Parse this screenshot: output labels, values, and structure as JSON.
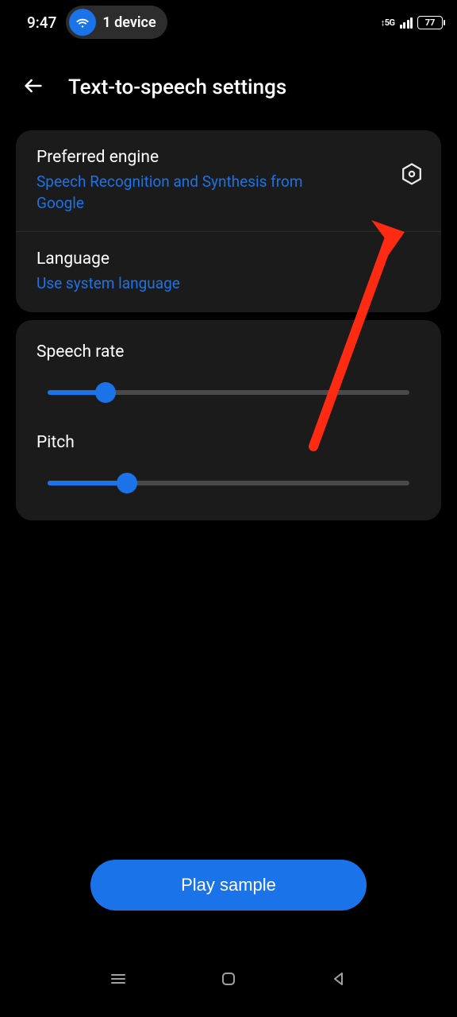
{
  "statusbar": {
    "time": "9:47",
    "deviceCount": "1 device",
    "network": "5G",
    "batteryPct": "77"
  },
  "header": {
    "title": "Text-to-speech settings"
  },
  "engine": {
    "title": "Preferred engine",
    "value": "Speech Recognition and Synthesis from Google"
  },
  "language": {
    "title": "Language",
    "value": "Use system language"
  },
  "speechRate": {
    "title": "Speech rate",
    "percent": 16
  },
  "pitch": {
    "title": "Pitch",
    "percent": 22
  },
  "playButton": {
    "label": "Play sample"
  }
}
